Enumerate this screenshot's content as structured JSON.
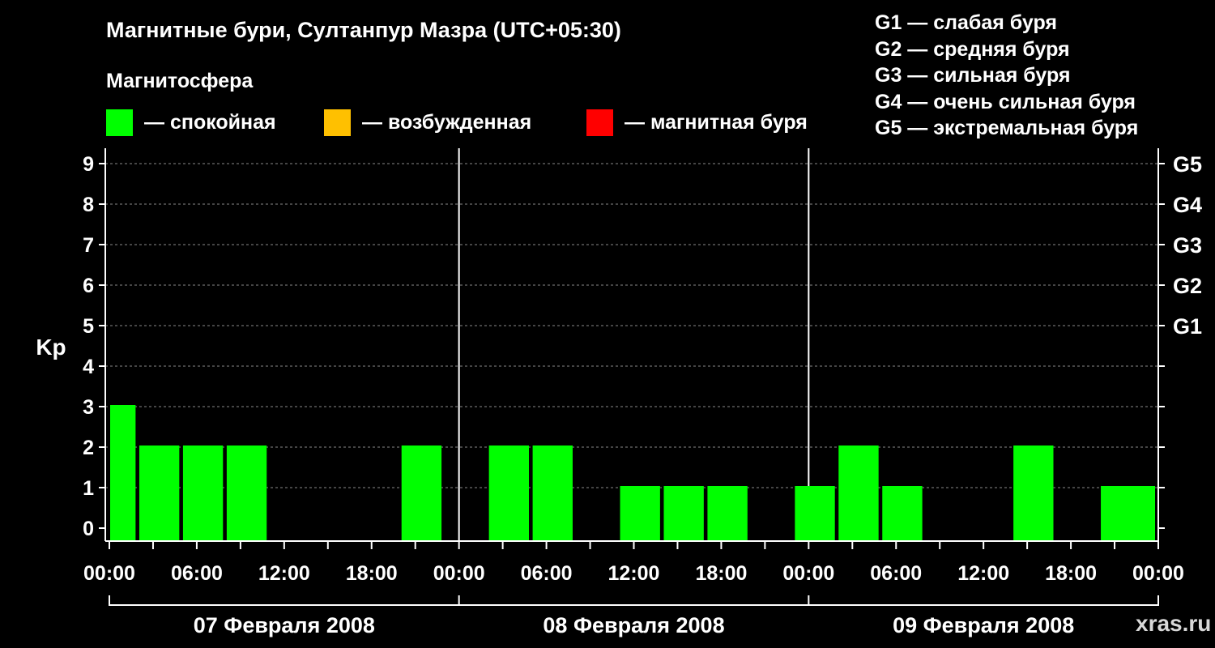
{
  "chart_data": {
    "type": "bar",
    "title": "Магнитные бури, Султанпур Мазра (UTC+05:30)",
    "subtitle": "Магнитосфера",
    "ylabel": "Kp",
    "ylim": [
      0,
      9
    ],
    "yticks": [
      "0",
      "1",
      "2",
      "3",
      "4",
      "5",
      "6",
      "7",
      "8",
      "9"
    ],
    "gticks": [
      {
        "kp": 5,
        "label": "G1"
      },
      {
        "kp": 6,
        "label": "G2"
      },
      {
        "kp": 7,
        "label": "G3"
      },
      {
        "kp": 8,
        "label": "G4"
      },
      {
        "kp": 9,
        "label": "G5"
      }
    ],
    "xticks": [
      "00:00",
      "06:00",
      "12:00",
      "18:00",
      "00:00",
      "06:00",
      "12:00",
      "18:00",
      "00:00",
      "06:00",
      "12:00",
      "18:00",
      "00:00"
    ],
    "days": [
      "07 Февраля 2008",
      "08 Февраля 2008",
      "09 Февраля 2008"
    ],
    "grid": true,
    "legend": [
      {
        "label": "— спокойная",
        "color": "#00ff00"
      },
      {
        "label": "— возбужденная",
        "color": "#ffc000"
      },
      {
        "label": "— магнитная буря",
        "color": "#ff0000"
      }
    ],
    "scale": [
      "G1 — слабая буря",
      "G2 — средняя буря",
      "G3 — сильная буря",
      "G4 — очень сильная буря",
      "G5 — экстремальная буря"
    ],
    "bars": [
      {
        "start_hour": 0,
        "end_hour": 1.8,
        "value": 3
      },
      {
        "start_hour": 2,
        "end_hour": 4.8,
        "value": 2
      },
      {
        "start_hour": 5,
        "end_hour": 7.8,
        "value": 2
      },
      {
        "start_hour": 8,
        "end_hour": 10.8,
        "value": 2
      },
      {
        "start_hour": 11,
        "end_hour": 13.8,
        "value": 0
      },
      {
        "start_hour": 14,
        "end_hour": 16.8,
        "value": 0
      },
      {
        "start_hour": 17,
        "end_hour": 19.8,
        "value": 0
      },
      {
        "start_hour": 20,
        "end_hour": 22.8,
        "value": 2
      },
      {
        "start_hour": 23,
        "end_hour": 25.8,
        "value": 0
      },
      {
        "start_hour": 26,
        "end_hour": 28.8,
        "value": 2
      },
      {
        "start_hour": 29,
        "end_hour": 31.8,
        "value": 2
      },
      {
        "start_hour": 32,
        "end_hour": 34.8,
        "value": 0
      },
      {
        "start_hour": 35,
        "end_hour": 37.8,
        "value": 1
      },
      {
        "start_hour": 38,
        "end_hour": 40.8,
        "value": 1
      },
      {
        "start_hour": 41,
        "end_hour": 43.8,
        "value": 1
      },
      {
        "start_hour": 44,
        "end_hour": 46.8,
        "value": 0
      },
      {
        "start_hour": 47,
        "end_hour": 49.8,
        "value": 1
      },
      {
        "start_hour": 50,
        "end_hour": 52.8,
        "value": 2
      },
      {
        "start_hour": 53,
        "end_hour": 55.8,
        "value": 1
      },
      {
        "start_hour": 56,
        "end_hour": 58.8,
        "value": 0
      },
      {
        "start_hour": 59,
        "end_hour": 61.8,
        "value": 0
      },
      {
        "start_hour": 62,
        "end_hour": 64.8,
        "value": 2
      },
      {
        "start_hour": 65,
        "end_hour": 67.8,
        "value": 0
      },
      {
        "start_hour": 68,
        "end_hour": 72,
        "value": 1
      }
    ]
  },
  "watermark": "xras.ru"
}
